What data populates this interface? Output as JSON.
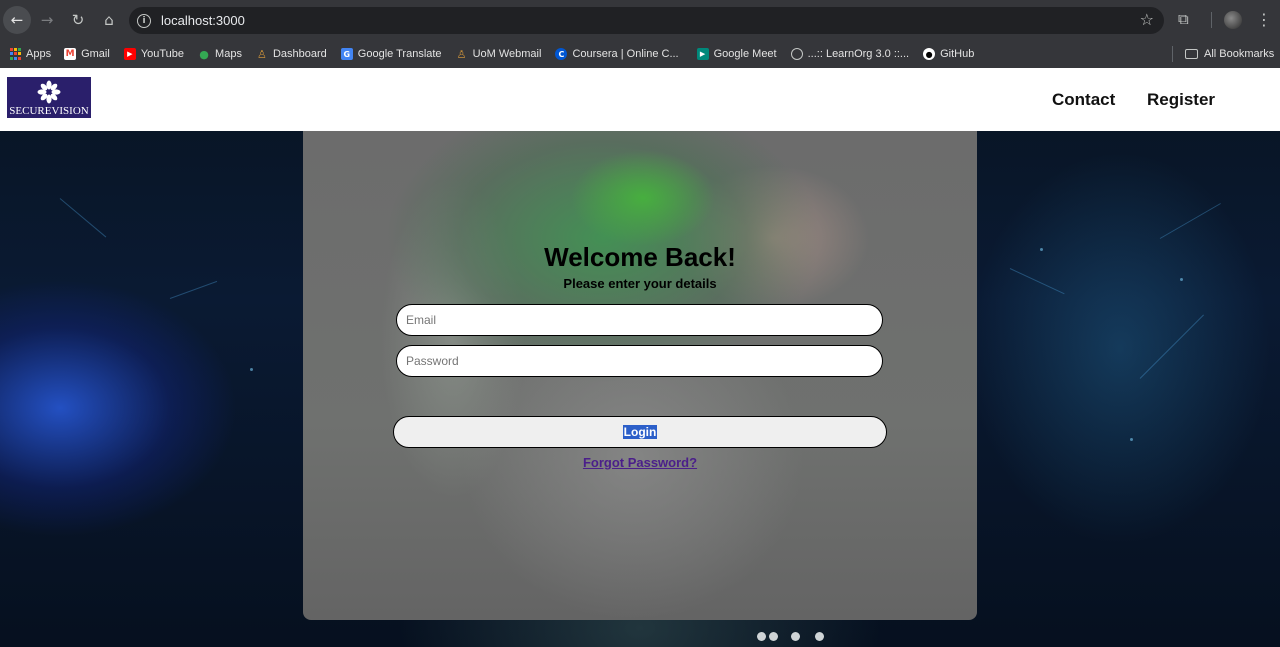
{
  "browser": {
    "url": "localhost:3000",
    "bookmarks": [
      {
        "label": "Apps",
        "icon": "apps-grid-icon"
      },
      {
        "label": "Gmail",
        "icon": "gmail-icon"
      },
      {
        "label": "YouTube",
        "icon": "youtube-icon"
      },
      {
        "label": "Maps",
        "icon": "maps-icon"
      },
      {
        "label": "Dashboard",
        "icon": "dashboard-icon"
      },
      {
        "label": "Google Translate",
        "icon": "translate-icon"
      },
      {
        "label": "UoM Webmail",
        "icon": "uom-icon"
      },
      {
        "label": "Coursera | Online C...",
        "icon": "coursera-icon"
      },
      {
        "label": "Google Meet",
        "icon": "meet-icon"
      },
      {
        "label": "...:: LearnOrg 3.0 ::...",
        "icon": "learnorg-icon"
      },
      {
        "label": "GitHub",
        "icon": "github-icon"
      }
    ],
    "all_bookmarks_label": "All Bookmarks"
  },
  "header": {
    "logo_text": "SECUREVISION",
    "nav": {
      "contact": "Contact",
      "register": "Register"
    }
  },
  "login": {
    "title": "Welcome Back!",
    "subtitle": "Please enter your details",
    "email_placeholder": "Email",
    "password_placeholder": "Password",
    "login_label": "Login",
    "forgot_label": "Forgot Password?"
  }
}
